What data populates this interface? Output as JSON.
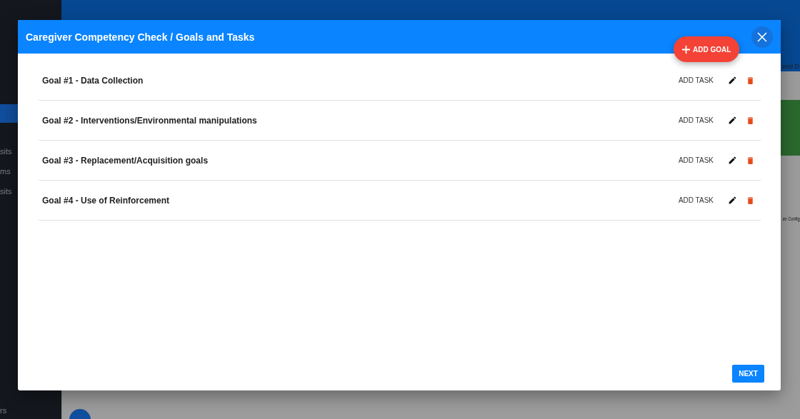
{
  "background": {
    "sidebar": {
      "items": [
        {
          "selected": true
        },
        {
          "label": "sits",
          "selected": false
        },
        {
          "label": "ms",
          "selected": false
        },
        {
          "label": "sits",
          "selected": false
        }
      ],
      "footer_label": "rs"
    },
    "main": {
      "column_header": "ired D",
      "card_caption": "ze Config"
    }
  },
  "dialog": {
    "title": "Caregiver Competency Check / Goals and Tasks",
    "add_goal_label": "ADD GOAL",
    "goals": [
      {
        "label": "Goal #1 - Data Collection",
        "add_task_label": "ADD TASK"
      },
      {
        "label": "Goal #2 - Interventions/Environmental manipulations",
        "add_task_label": "ADD TASK"
      },
      {
        "label": "Goal #3 - Replacement/Acquisition goals",
        "add_task_label": "ADD TASK"
      },
      {
        "label": "Goal #4 - Use of Reinforcement",
        "add_task_label": "ADD TASK"
      }
    ],
    "next_label": "NEXT"
  }
}
